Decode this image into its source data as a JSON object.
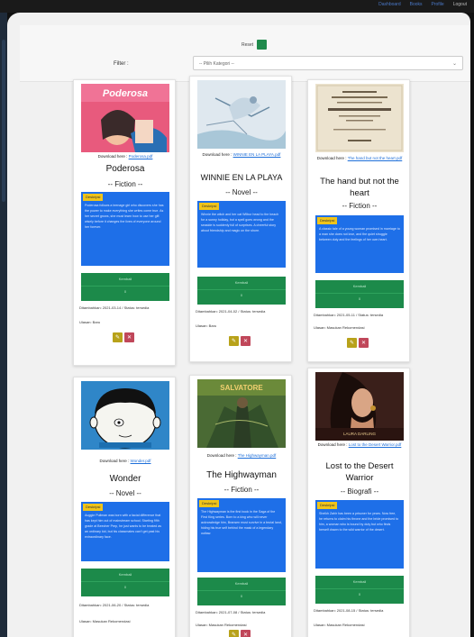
{
  "topbar": {
    "links": [
      "Dashboard",
      "Books",
      "Profile",
      "Logout"
    ]
  },
  "filterbar": {
    "reset_label": "Reset",
    "filter_label": "Filter :",
    "filter_placeholder": "-- Pilih Kategori --"
  },
  "cards": [
    {
      "cover": "pink",
      "download_label": "Download here : ",
      "download_link": "Poderosa.pdf",
      "title": "Poderosa",
      "genre": "-- Fiction --",
      "tag": "Deskripsi",
      "description": "Poderosa follows a teenage girl who discovers she has the power to make everything she writes come true. As her secret grows, she must learn how to use her gift wisely before it changes the lives of everyone around her forever.",
      "box_label": "Kembali",
      "box_value": "0",
      "meta1": "Ditambahkan: 2021-03-14 / Status: tersedia",
      "meta2": "Ulasan: Baru",
      "edit_label": "✎",
      "delete_label": "✕"
    },
    {
      "cover": "sketch",
      "download_label": "Download here : ",
      "download_link": "WINNIE EN LA PLAYA.pdf",
      "title": "WINNIE EN LA PLAYA",
      "genre": "-- Novel --",
      "tag": "Deskripsi",
      "description": "Winnie the witch and her cat Wilbur head to the beach for a sunny holiday, but a spell goes wrong and the seaside is suddenly full of surprises. A cheerful story about friendship and magic on the shore.",
      "box_label": "Kembali",
      "box_value": "0",
      "meta1": "Ditambahkan: 2021-04-02 / Status: tersedia",
      "meta2": "Ulasan: Baru",
      "edit_label": "✎",
      "delete_label": "✕"
    },
    {
      "cover": "oldpage",
      "download_label": "Download here : ",
      "download_link": "The hand but not the heart.pdf",
      "title": "The hand but not the heart",
      "genre": "-- Fiction --",
      "tag": "Deskripsi",
      "description": "A classic tale of a young woman promised in marriage to a man she does not love, and the quiet struggle between duty and the feelings of her own heart.",
      "box_label": "Kembali",
      "box_value": "0",
      "meta1": "Ditambahkan: 2021-05-11 / Status: tersedia",
      "meta2": "Ulasan: Masukan Rekomendasi",
      "edit_label": "✎",
      "delete_label": "✕"
    },
    {
      "cover": "wonder",
      "download_label": "Download here : ",
      "download_link": "Wonder.pdf",
      "title": "Wonder",
      "genre": "-- Novel --",
      "tag": "Deskripsi",
      "description": "Auggie Pullman was born with a facial difference that has kept him out of mainstream school. Starting fifth grade at Beecher Prep, he just wants to be treated as an ordinary kid, but his classmates can't get past his extraordinary face.",
      "box_label": "Kembali",
      "box_value": "0",
      "meta1": "Ditambahkan: 2021-06-20 / Status: tersedia",
      "meta2": "Ulasan: Masukan Rekomendasi",
      "edit_label": "✎",
      "delete_label": "✕"
    },
    {
      "cover": "highwayman",
      "download_label": "Download here : ",
      "download_link": "The Highwayman.pdf",
      "title": "The Highwayman",
      "genre": "-- Fiction --",
      "tag": "Deskripsi",
      "description": "The Highwayman is the first book in the Saga of the First King series. Born to a king who will never acknowledge him, Bransen must survive in a brutal land, hiding his true self behind the mask of a legendary outlaw.",
      "box_label": "Kembali",
      "box_value": "0",
      "meta1": "Ditambahkan: 2021-07-08 / Status: tersedia",
      "meta2": "Ulasan: Masukan Rekomendasi",
      "edit_label": "✎",
      "delete_label": "✕"
    },
    {
      "cover": "desert",
      "download_label": "Download here : ",
      "download_link": "Lost to the Desert Warrior.pdf",
      "title": "Lost to the Desert Warrior",
      "genre": "-- Biografi --",
      "tag": "Deskripsi",
      "description": "Sheikh Zahir has been a prisoner for years. Now free, he returns to claim his throne and the bride promised to him, a woman who is bound by duty but who finds herself drawn to the wild warrior of the desert.",
      "box_label": "Kembali",
      "box_value": "0",
      "meta1": "Ditambahkan: 2021-08-15 / Status: tersedia",
      "meta2": "Ulasan: Masukan Rekomendasi",
      "edit_label": "✎",
      "delete_label": "✕"
    }
  ]
}
